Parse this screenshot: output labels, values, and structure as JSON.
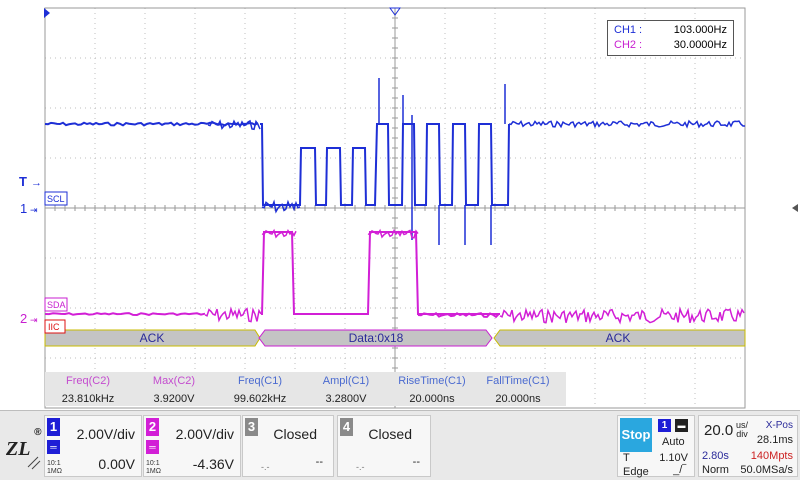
{
  "freq_counter": {
    "rows": [
      {
        "label": "CH1 :",
        "value": "103.000Hz",
        "color": "#1e2fd6"
      },
      {
        "label": "CH2 :",
        "value": "30.0000Hz",
        "color": "#c81fd0"
      }
    ]
  },
  "labels": {
    "scl": "SCL",
    "sda": "SDA",
    "iic": "IIC",
    "ch1_marker": "1",
    "ch2_marker": "2",
    "trig_marker": "T"
  },
  "decode": {
    "segments": [
      "ACK",
      "Data:0x18",
      "ACK"
    ]
  },
  "measurements": [
    {
      "label": "Freq(C2)",
      "value": "23.810kHz",
      "ch": 2
    },
    {
      "label": "Max(C2)",
      "value": "3.9200V",
      "ch": 2
    },
    {
      "label": "Freq(C1)",
      "value": "99.602kHz",
      "ch": 1
    },
    {
      "label": "Ampl(C1)",
      "value": "3.2800V",
      "ch": 1
    },
    {
      "label": "RiseTime(C1)",
      "value": "20.000ns",
      "ch": 1
    },
    {
      "label": "FallTime(C1)",
      "value": "20.000ns",
      "ch": 1
    }
  ],
  "channels": [
    {
      "num": "1",
      "vdiv": "2.00V/div",
      "offset": "0.00V",
      "imp": "10:1\n1MΩ",
      "color": "#1e1ed6"
    },
    {
      "num": "2",
      "vdiv": "2.00V/div",
      "offset": "-4.36V",
      "imp": "10:1\n1MΩ",
      "color": "#d21fd6"
    },
    {
      "num": "3",
      "vdiv": "Closed",
      "offset": "--",
      "color": "#8a8a8a"
    },
    {
      "num": "4",
      "vdiv": "Closed",
      "offset": "--",
      "color": "#8a8a8a"
    }
  ],
  "trigger": {
    "state": "Stop",
    "source": "1",
    "mode": "Auto",
    "level_label": "T",
    "level": "1.10V",
    "type": "Edge"
  },
  "timebase": {
    "value": "20.0",
    "unit_top": "us/",
    "unit_bottom": "div",
    "xpos_label": "X-Pos",
    "xpos_value": "28.1ms",
    "mem_time": "2.80s",
    "mem_depth": "140Mpts",
    "acq_mode": "Norm",
    "sample_rate": "50.0MSa/s"
  },
  "brand": "ZLG"
}
